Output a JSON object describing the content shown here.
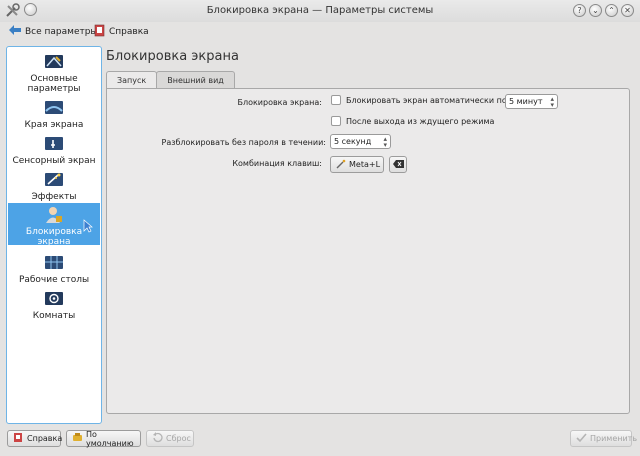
{
  "window": {
    "title": "Блокировка экрана — Параметры системы"
  },
  "toolbar": {
    "all_settings": "Все параметры",
    "help": "Справка"
  },
  "sidebar": {
    "items": [
      {
        "label": "Основные параметры"
      },
      {
        "label": "Края экрана"
      },
      {
        "label": "Сенсорный экран"
      },
      {
        "label": "Эффекты"
      },
      {
        "label": "Блокировка экрана"
      },
      {
        "label": "Рабочие столы"
      },
      {
        "label": "Комнаты"
      }
    ]
  },
  "page": {
    "title": "Блокировка экрана"
  },
  "tabs": [
    {
      "label": "Запуск"
    },
    {
      "label": "Внешний вид"
    }
  ],
  "form": {
    "lock_label": "Блокировка экрана:",
    "auto_lock": "Блокировать экран автоматически после:",
    "auto_lock_value": "5 минут",
    "after_resume": "После выхода из ждущего режима",
    "grace_label": "Разблокировать без пароля в течении:",
    "grace_value": "5 секунд",
    "shortcut_label": "Комбинация клавиш:",
    "shortcut_value": "Meta+L"
  },
  "buttons": {
    "help": "Справка",
    "defaults": "По умолчанию",
    "reset": "Сброс",
    "apply": "Применить"
  }
}
